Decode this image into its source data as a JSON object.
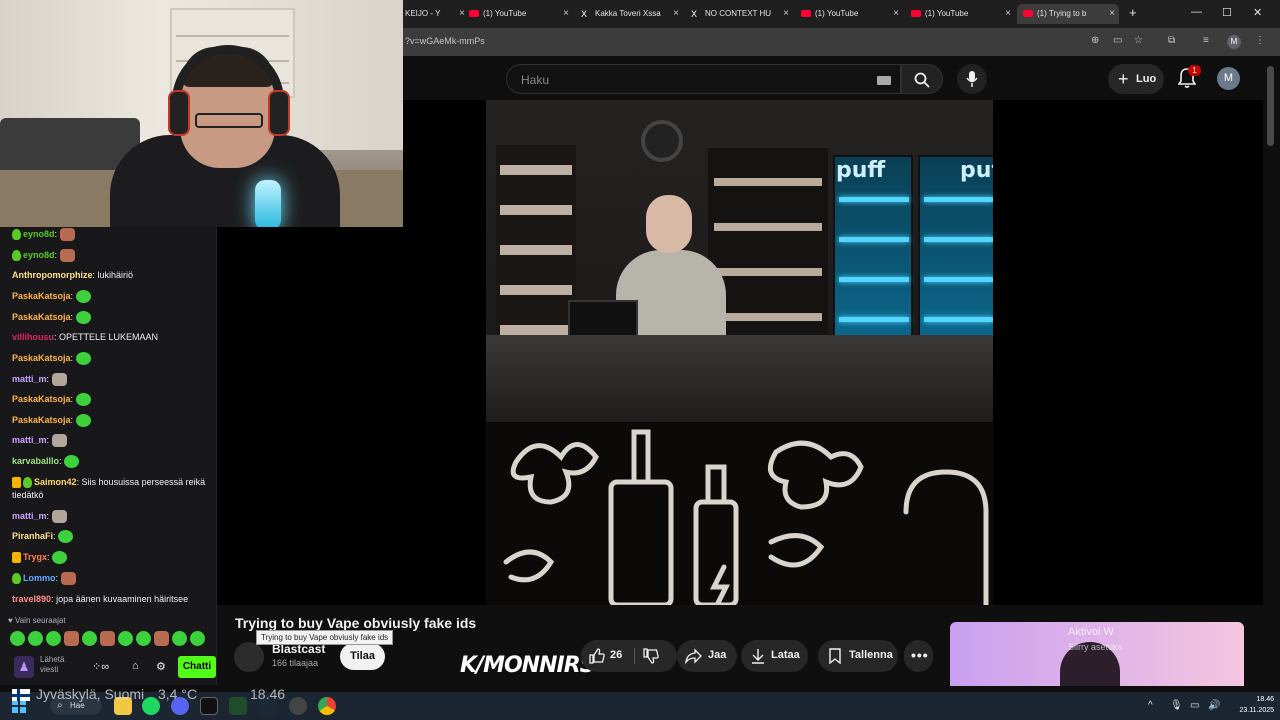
{
  "browser": {
    "tabs": [
      {
        "label": "KEIJO - Y",
        "favicon": "youtube",
        "active": false
      },
      {
        "label": "(1) YouTube",
        "favicon": "youtube",
        "active": false
      },
      {
        "label": "Kakka Toveri Xssa",
        "favicon": "x",
        "active": false
      },
      {
        "label": "NO CONTEXT HU",
        "favicon": "x",
        "active": false
      },
      {
        "label": "(1) YouTube",
        "favicon": "youtube",
        "active": false
      },
      {
        "label": "(1) YouTube",
        "favicon": "youtube",
        "active": false
      },
      {
        "label": "(1) Trying to b",
        "favicon": "youtube",
        "active": true
      }
    ],
    "url": "?v=wGAeMk-mmPs",
    "profile_initial": "M"
  },
  "youtube": {
    "search_placeholder": "Haku",
    "create_label": "Luo",
    "notification_count": "1",
    "avatar_initial": "M",
    "video_title": "Trying to buy Vape obviusly fake ids",
    "tooltip": "Trying to buy Vape obviusly fake ids",
    "channel_name": "Blastcast",
    "subscribers": "166 tilaajaa",
    "subscribe_label": "Tilaa",
    "like_count": "26",
    "share_label": "Jaa",
    "download_label": "Lataa",
    "save_label": "Tallenna",
    "recommended": {
      "line1": "Aktivoi W",
      "line2": "Siirry asetuks"
    },
    "video_signs": [
      "puff",
      "puff"
    ]
  },
  "chat": {
    "messages": [
      {
        "user": "eyno8d",
        "text": "",
        "color": "#5bc926",
        "emote": "face",
        "badge": "sub"
      },
      {
        "user": "eyno8d",
        "text": "",
        "color": "#5bc926",
        "emote": "face",
        "badge": "sub"
      },
      {
        "user": "Anthropomorphize",
        "text": " lukihäiriö",
        "color": "#ffe08a",
        "emote": "",
        "badge": ""
      },
      {
        "user": "PaskaKatsoja",
        "text": "",
        "color": "#ffb347",
        "emote": "green",
        "badge": ""
      },
      {
        "user": "PaskaKatsoja",
        "text": "",
        "color": "#ffb347",
        "emote": "green",
        "badge": ""
      },
      {
        "user": "villihousu",
        "text": " OPETTELE LUKEMAAN",
        "color": "#e0245e",
        "emote": "",
        "badge": ""
      },
      {
        "user": "PaskaKatsoja",
        "text": "",
        "color": "#ffb347",
        "emote": "green",
        "badge": ""
      },
      {
        "user": "matti_m",
        "text": "",
        "color": "#c9a0ff",
        "emote": "cat",
        "badge": ""
      },
      {
        "user": "PaskaKatsoja",
        "text": "",
        "color": "#ffb347",
        "emote": "green",
        "badge": ""
      },
      {
        "user": "PaskaKatsoja",
        "text": "",
        "color": "#ffb347",
        "emote": "green",
        "badge": ""
      },
      {
        "user": "matti_m",
        "text": "",
        "color": "#c9a0ff",
        "emote": "cat",
        "badge": ""
      },
      {
        "user": "karvaballlo",
        "text": "",
        "color": "#9be37a",
        "emote": "green",
        "badge": ""
      },
      {
        "user": "Saimon42",
        "text": " Siis housuissa perseessä reikä tiedätkö",
        "color": "#ffd966",
        "emote": "",
        "badge": "crown"
      },
      {
        "user": "matti_m",
        "text": "",
        "color": "#c9a0ff",
        "emote": "cat",
        "badge": ""
      },
      {
        "user": "PiranhaFi",
        "text": "",
        "color": "#ffe08a",
        "emote": "green",
        "badge": ""
      },
      {
        "user": "Trygx",
        "text": "",
        "color": "#ff7f50",
        "emote": "green",
        "badge": "crown"
      },
      {
        "user": "Lommo",
        "text": "",
        "color": "#5fa8ff",
        "emote": "face",
        "badge": "sub"
      },
      {
        "user": "travel890",
        "text": " jopa äänen kuvaaminen häiritsee",
        "color": "#ff8c8c",
        "emote": "",
        "badge": ""
      }
    ],
    "followers_only": "Vain seuraajat",
    "send_label": "Lähetä viesti",
    "chat_button": "Chatti"
  },
  "overlay": {
    "weather_location": "Jyväskylä, Suomi",
    "temperature": "3,4 °C",
    "weather_time": "18.46",
    "kick_logo": "K/MONNIRS"
  },
  "taskbar": {
    "search_label": "Hae",
    "time": "18.46",
    "date": "23.11.2025"
  },
  "colors": {
    "accent_kick": "#53fc18",
    "youtube_red": "#ff0033",
    "bg": "#0f0f0f"
  }
}
